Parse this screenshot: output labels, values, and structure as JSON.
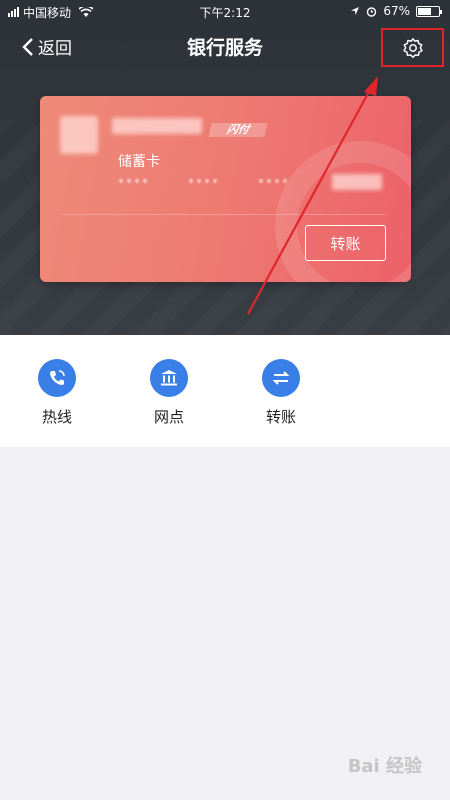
{
  "status_bar": {
    "carrier": "中国移动",
    "time": "下午2:12",
    "battery_pct": "67%",
    "battery_level": 0.67
  },
  "nav": {
    "back_label": "返回",
    "title": "银行服务"
  },
  "card": {
    "badge": "闪付",
    "card_type": "储蓄卡",
    "mask_1": "****",
    "mask_2": "****",
    "mask_3": "****",
    "transfer_label": "转账"
  },
  "shortcuts": [
    {
      "label": "热线",
      "icon": "phone-icon"
    },
    {
      "label": "网点",
      "icon": "bank-icon"
    },
    {
      "label": "转账",
      "icon": "transfer-icon"
    }
  ],
  "watermark": {
    "text": "Bai 经验"
  },
  "colors": {
    "header_bg": "#2d3138",
    "card_gradient_start": "#ee8a78",
    "card_gradient_end": "#ec6168",
    "icon_blue": "#3a7ee8",
    "highlight_red": "#e0262a"
  }
}
